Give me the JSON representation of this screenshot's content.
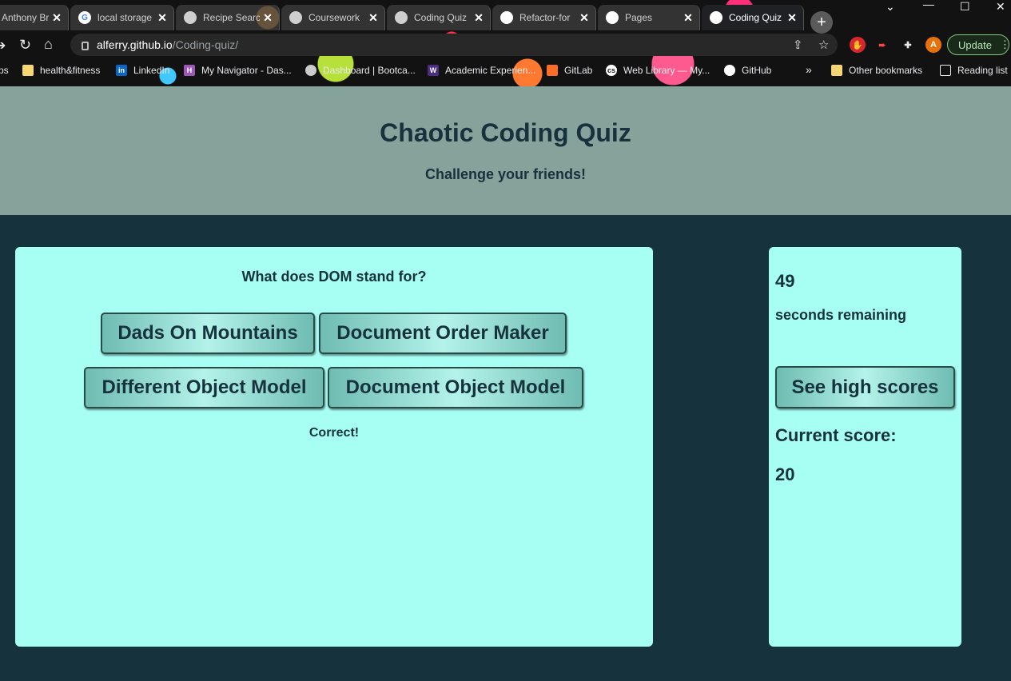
{
  "browser": {
    "tabs": [
      {
        "title": "Anthony Bro"
      },
      {
        "title": "local storage"
      },
      {
        "title": "Recipe Searc"
      },
      {
        "title": "Coursework"
      },
      {
        "title": "Coding Quiz"
      },
      {
        "title": "Refactor-for"
      },
      {
        "title": "Pages"
      },
      {
        "title": "Coding Quiz"
      }
    ],
    "url_host": "alferry.github.io",
    "url_path": "/Coding-quiz/",
    "update_label": "Update",
    "profile_initial": "A",
    "bookmarks": [
      "ps",
      "health&fitness",
      "LinkedIn",
      "My Navigator - Das...",
      "Dashboard | Bootca...",
      "Academic Experien...",
      "GitLab",
      "Web Library — My...",
      "GitHub"
    ],
    "bookmarks_overflow": "»",
    "other_bookmarks": "Other bookmarks",
    "reading_list": "Reading list"
  },
  "header": {
    "title": "Chaotic Coding Quiz",
    "subtitle": "Challenge your friends!"
  },
  "quiz": {
    "question": "What does DOM stand for?",
    "answers": [
      "Dads On Mountains",
      "Document Order Maker",
      "Different Object Model",
      "Document Object Model"
    ],
    "feedback": "Correct!"
  },
  "sidebar": {
    "timer_value": "49",
    "timer_label": "seconds remaining",
    "high_scores_label": "See high scores",
    "score_label": "Current score:",
    "score_value": "20"
  },
  "colors": {
    "page_bg": "#16323d",
    "header_bg": "#86a39b",
    "card_bg": "#a7fff4",
    "text": "#16323d"
  }
}
